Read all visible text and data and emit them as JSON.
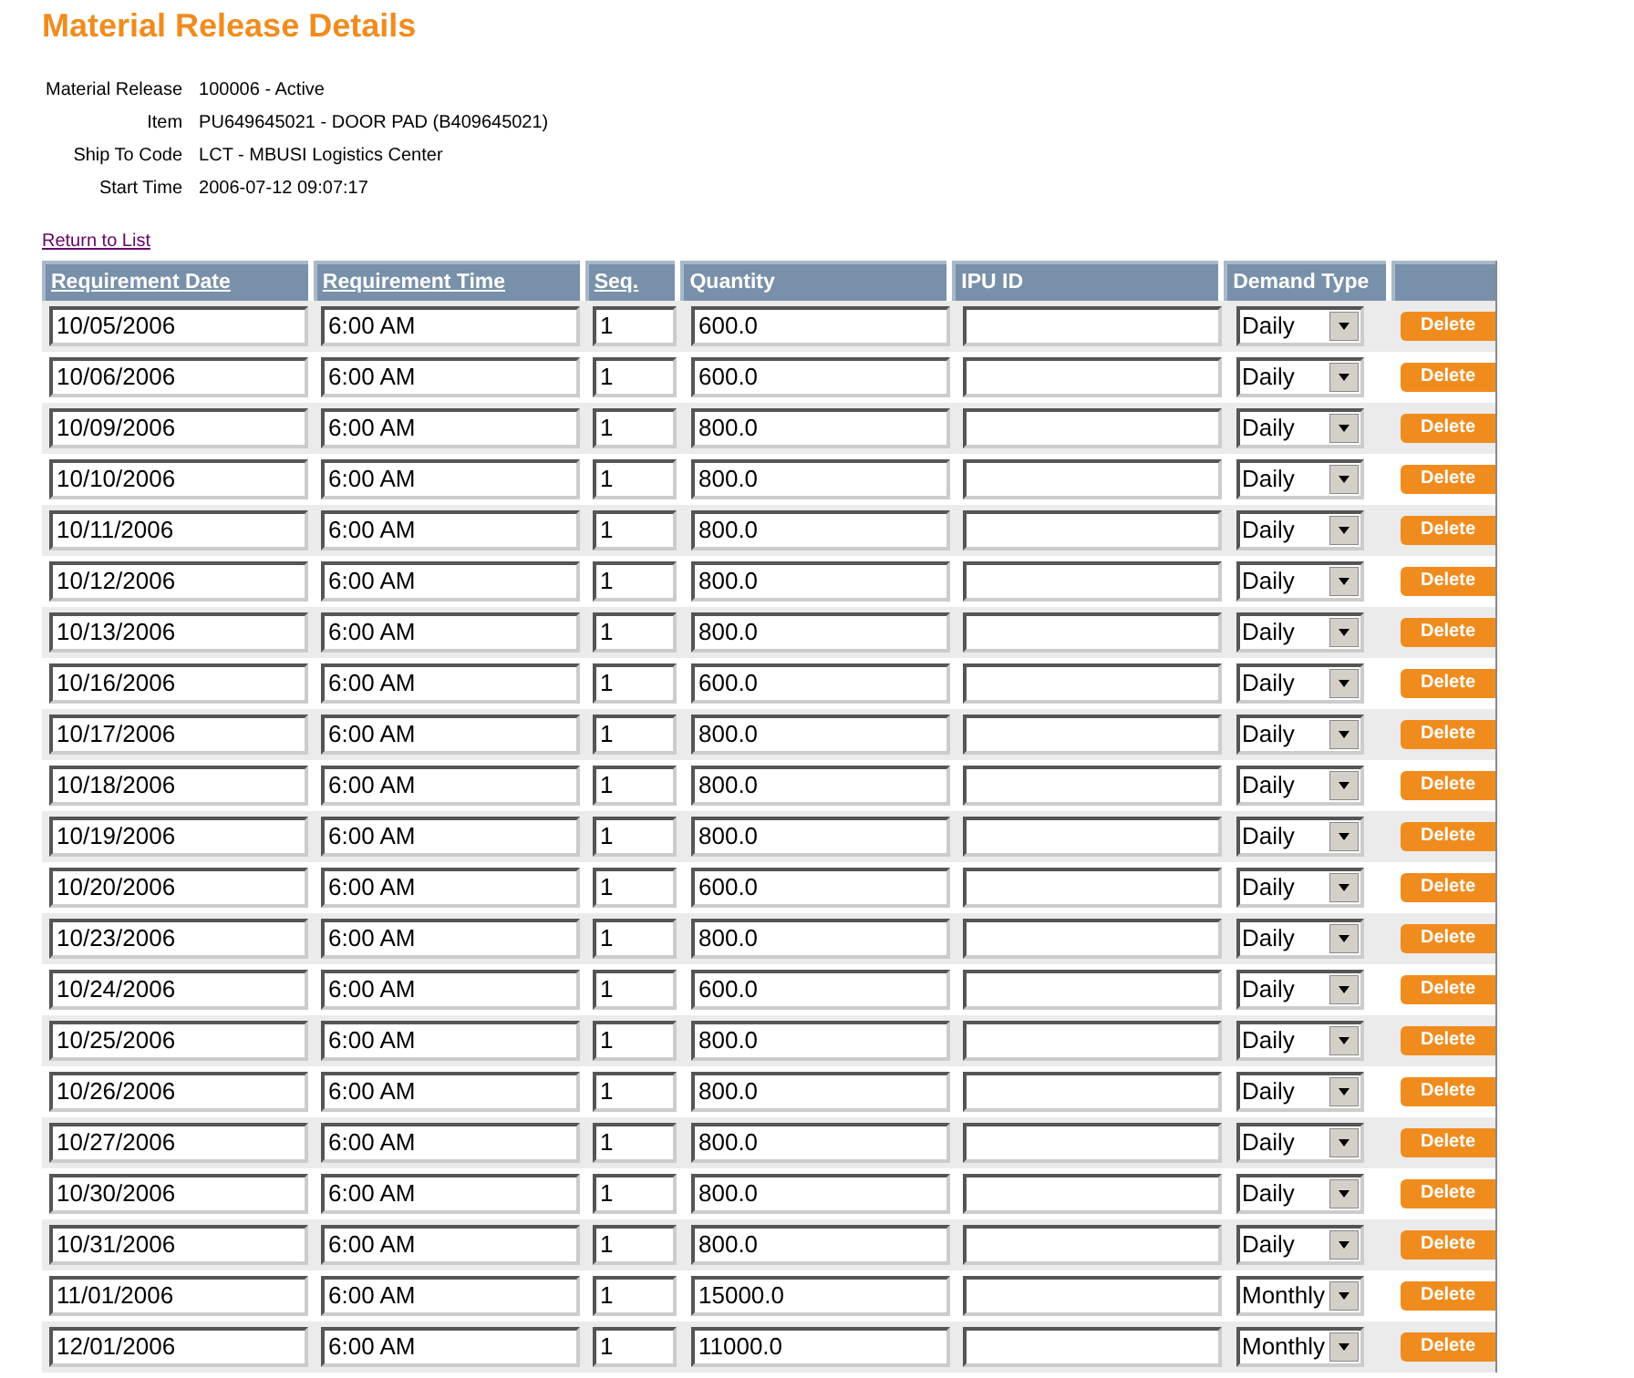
{
  "title": "Material Release Details",
  "details": [
    {
      "label": "Material Release",
      "value": "100006 - Active"
    },
    {
      "label": "Item",
      "value": "PU649645021 - DOOR PAD (B409645021)"
    },
    {
      "label": "Ship To Code",
      "value": "LCT - MBUSI Logistics Center"
    },
    {
      "label": "Start Time",
      "value": "2006-07-12 09:07:17"
    }
  ],
  "return_link": "Return to List",
  "table": {
    "columns": [
      {
        "label": "Requirement Date",
        "sortable": true
      },
      {
        "label": "Requirement Time",
        "sortable": true
      },
      {
        "label": "Seq.",
        "sortable": true
      },
      {
        "label": "Quantity",
        "sortable": false
      },
      {
        "label": "IPU ID",
        "sortable": false
      },
      {
        "label": "Demand Type",
        "sortable": false
      }
    ],
    "rows": [
      {
        "date": "10/05/2006",
        "time": "6:00 AM",
        "seq": "1",
        "quantity": "600.0",
        "demand_type": "Daily",
        "action": "Delete"
      },
      {
        "date": "10/06/2006",
        "time": "6:00 AM",
        "seq": "1",
        "quantity": "600.0",
        "demand_type": "Daily",
        "action": "Delete"
      },
      {
        "date": "10/09/2006",
        "time": "6:00 AM",
        "seq": "1",
        "quantity": "800.0",
        "demand_type": "Daily",
        "action": "Delete"
      },
      {
        "date": "10/10/2006",
        "time": "6:00 AM",
        "seq": "1",
        "quantity": "800.0",
        "demand_type": "Daily",
        "action": "Delete"
      },
      {
        "date": "10/11/2006",
        "time": "6:00 AM",
        "seq": "1",
        "quantity": "800.0",
        "demand_type": "Daily",
        "action": "Delete"
      },
      {
        "date": "10/12/2006",
        "time": "6:00 AM",
        "seq": "1",
        "quantity": "800.0",
        "demand_type": "Daily",
        "action": "Delete"
      },
      {
        "date": "10/13/2006",
        "time": "6:00 AM",
        "seq": "1",
        "quantity": "800.0",
        "demand_type": "Daily",
        "action": "Delete"
      },
      {
        "date": "10/16/2006",
        "time": "6:00 AM",
        "seq": "1",
        "quantity": "600.0",
        "demand_type": "Daily",
        "action": "Delete"
      },
      {
        "date": "10/17/2006",
        "time": "6:00 AM",
        "seq": "1",
        "quantity": "800.0",
        "demand_type": "Daily",
        "action": "Delete"
      },
      {
        "date": "10/18/2006",
        "time": "6:00 AM",
        "seq": "1",
        "quantity": "800.0",
        "demand_type": "Daily",
        "action": "Delete"
      },
      {
        "date": "10/19/2006",
        "time": "6:00 AM",
        "seq": "1",
        "quantity": "800.0",
        "demand_type": "Daily",
        "action": "Delete"
      },
      {
        "date": "10/20/2006",
        "time": "6:00 AM",
        "seq": "1",
        "quantity": "600.0",
        "demand_type": "Daily",
        "action": "Delete"
      },
      {
        "date": "10/23/2006",
        "time": "6:00 AM",
        "seq": "1",
        "quantity": "800.0",
        "demand_type": "Daily",
        "action": "Delete"
      },
      {
        "date": "10/24/2006",
        "time": "6:00 AM",
        "seq": "1",
        "quantity": "600.0",
        "demand_type": "Daily",
        "action": "Delete"
      },
      {
        "date": "10/25/2006",
        "time": "6:00 AM",
        "seq": "1",
        "quantity": "800.0",
        "demand_type": "Daily",
        "action": "Delete"
      },
      {
        "date": "10/26/2006",
        "time": "6:00 AM",
        "seq": "1",
        "quantity": "800.0",
        "demand_type": "Daily",
        "action": "Delete"
      },
      {
        "date": "10/27/2006",
        "time": "6:00 AM",
        "seq": "1",
        "quantity": "800.0",
        "demand_type": "Daily",
        "action": "Delete"
      },
      {
        "date": "10/30/2006",
        "time": "6:00 AM",
        "seq": "1",
        "quantity": "800.0",
        "demand_type": "Daily",
        "action": "Delete"
      },
      {
        "date": "10/31/2006",
        "time": "6:00 AM",
        "seq": "1",
        "quantity": "800.0",
        "demand_type": "Daily",
        "action": "Delete"
      },
      {
        "date": "11/01/2006",
        "time": "6:00 AM",
        "seq": "1",
        "quantity": "15000.0",
        "demand_type": "Monthly",
        "action": "Delete"
      },
      {
        "date": "12/01/2006",
        "time": "6:00 AM",
        "seq": "1",
        "quantity": "11000.0",
        "demand_type": "Monthly",
        "action": "Delete"
      }
    ]
  }
}
